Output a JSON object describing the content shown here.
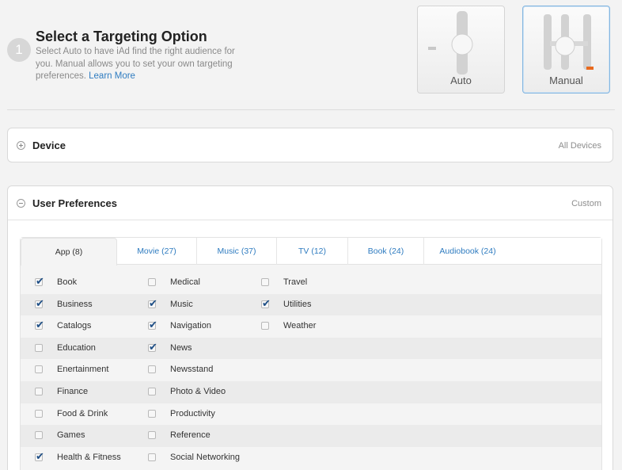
{
  "header": {
    "step": "1",
    "title": "Select a Targeting Option",
    "description": "Select Auto to have iAd find the right audience for you. Manual allows you to set your own targeting preferences.",
    "learn_more": "Learn More"
  },
  "options": {
    "auto_label": "Auto",
    "manual_label": "Manual",
    "selected": "Manual",
    "accent": "#e8691d"
  },
  "device": {
    "title": "Device",
    "value": "All Devices"
  },
  "prefs": {
    "title": "User Preferences",
    "value": "Custom",
    "tabs": [
      {
        "label": "App (8)",
        "active": true
      },
      {
        "label": "Movie (27)"
      },
      {
        "label": "Music (37)"
      },
      {
        "label": "TV (12)"
      },
      {
        "label": "Book (24)"
      },
      {
        "label": "Audiobook (24)"
      }
    ],
    "columns": [
      [
        {
          "label": "Book",
          "checked": true
        },
        {
          "label": "Business",
          "checked": true
        },
        {
          "label": "Catalogs",
          "checked": true
        },
        {
          "label": "Education",
          "checked": false
        },
        {
          "label": "Enertainment",
          "checked": false
        },
        {
          "label": "Finance",
          "checked": false
        },
        {
          "label": "Food & Drink",
          "checked": false
        },
        {
          "label": "Games",
          "checked": false
        },
        {
          "label": "Health & Fitness",
          "checked": true
        }
      ],
      [
        {
          "label": "Medical",
          "checked": false
        },
        {
          "label": "Music",
          "checked": true
        },
        {
          "label": "Navigation",
          "checked": true
        },
        {
          "label": "News",
          "checked": true
        },
        {
          "label": "Newsstand",
          "checked": false
        },
        {
          "label": "Photo & Video",
          "checked": false
        },
        {
          "label": "Productivity",
          "checked": false
        },
        {
          "label": "Reference",
          "checked": false
        },
        {
          "label": "Social Networking",
          "checked": false
        }
      ],
      [
        {
          "label": "Travel",
          "checked": false
        },
        {
          "label": "Utilities",
          "checked": true
        },
        {
          "label": "Weather",
          "checked": false
        }
      ]
    ]
  },
  "colors": {
    "link": "#2f7cc0",
    "check": "#1f4f86"
  }
}
